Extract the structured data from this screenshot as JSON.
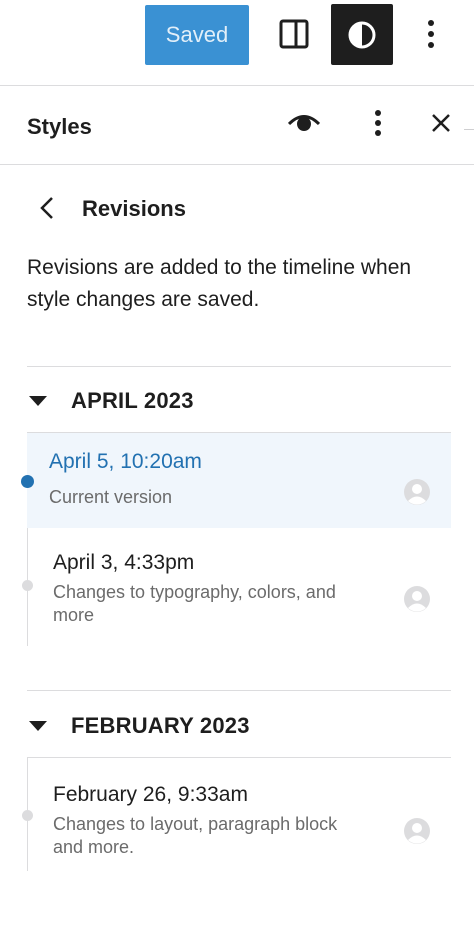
{
  "toolbar": {
    "saved_label": "Saved"
  },
  "styles_header": {
    "title": "Styles"
  },
  "revisions": {
    "title": "Revisions",
    "description_line1": "Revisions are added to the timeline when",
    "description_line2": "style changes are saved."
  },
  "months": [
    {
      "label": "APRIL 2023",
      "items": [
        {
          "date": "April 5, 10:20am",
          "desc_line1": "Current version",
          "desc_line2": ""
        },
        {
          "date": "April 3, 4:33pm",
          "desc_line1": "Changes to typography, colors, and",
          "desc_line2": "more"
        }
      ]
    },
    {
      "label": "FEBRUARY 2023",
      "items": [
        {
          "date": "February 26, 9:33am",
          "desc_line1": "Changes to layout, paragraph block",
          "desc_line2": "and more."
        }
      ]
    }
  ],
  "icons": {
    "toolbar": [
      "sidebar-view-icon",
      "contrast-icon",
      "more-vertical-icon"
    ],
    "header": [
      "eye-icon",
      "more-vertical-icon",
      "close-icon"
    ],
    "nav": [
      "chevron-left-icon"
    ],
    "month": [
      "caret-down-icon"
    ],
    "revision": [
      "avatar-icon"
    ]
  },
  "colors": {
    "accent": "#2271b1",
    "saved_button": "#3a91d3",
    "current_row_bg": "#f0f6fc",
    "dark_button": "#1e1e1e"
  }
}
